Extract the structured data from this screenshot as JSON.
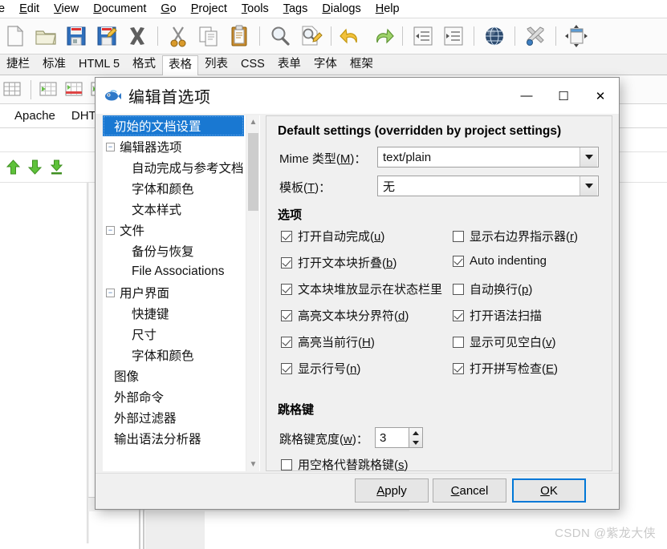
{
  "app": {
    "menubar": [
      {
        "label": "e",
        "full": "File"
      },
      {
        "label": "Edit"
      },
      {
        "label": "View"
      },
      {
        "label": "Document"
      },
      {
        "label": "Go"
      },
      {
        "label": "Project"
      },
      {
        "label": "Tools"
      },
      {
        "label": "Tags"
      },
      {
        "label": "Dialogs"
      },
      {
        "label": "Help"
      }
    ],
    "toolbar_icons": [
      "new-file-icon",
      "open-folder-icon",
      "save-icon",
      "save-as-icon",
      "close-x-icon",
      "cut-scissors-icon",
      "copy-icon",
      "paste-clipboard-icon",
      "find-magnifier-icon",
      "find-replace-icon",
      "undo-arrow-icon",
      "redo-arrow-icon",
      "unindent-icon",
      "indent-icon",
      "preview-globe-icon",
      "preferences-tools-icon",
      "fullscreen-icon"
    ],
    "tabs": [
      {
        "label": "捷栏",
        "active": false
      },
      {
        "label": "标准",
        "active": false
      },
      {
        "label": "HTML 5",
        "active": false
      },
      {
        "label": "格式",
        "active": false
      },
      {
        "label": "表格",
        "active": true
      },
      {
        "label": "列表",
        "active": false
      },
      {
        "label": "CSS",
        "active": false
      },
      {
        "label": "表单",
        "active": false
      },
      {
        "label": "字体",
        "active": false
      },
      {
        "label": "框架",
        "active": false
      }
    ],
    "taglibs": [
      "Apache",
      "DHT"
    ],
    "arrows": [
      "up-arrow-icon",
      "down-arrow-icon",
      "bottom-arrow-icon"
    ]
  },
  "dialog": {
    "title": "编辑首选项",
    "window_buttons": {
      "minimize": "—",
      "maximize": "☐",
      "close": "✕"
    },
    "tree": [
      {
        "label": "初始的文档设置",
        "level": 1,
        "expander": null,
        "selected": true
      },
      {
        "label": "编辑器选项",
        "level": 0,
        "expander": "minus",
        "selected": false
      },
      {
        "label": "自动完成与参考文档",
        "level": 2,
        "expander": null,
        "selected": false
      },
      {
        "label": "字体和颜色",
        "level": 2,
        "expander": null,
        "selected": false
      },
      {
        "label": "文本样式",
        "level": 2,
        "expander": null,
        "selected": false
      },
      {
        "label": "文件",
        "level": 0,
        "expander": "minus",
        "selected": false
      },
      {
        "label": "备份与恢复",
        "level": 2,
        "expander": null,
        "selected": false
      },
      {
        "label": "File Associations",
        "level": 2,
        "expander": null,
        "selected": false
      },
      {
        "label": "用户界面",
        "level": 0,
        "expander": "minus",
        "selected": false
      },
      {
        "label": "快捷键",
        "level": 2,
        "expander": null,
        "selected": false
      },
      {
        "label": "尺寸",
        "level": 2,
        "expander": null,
        "selected": false
      },
      {
        "label": "字体和颜色",
        "level": 2,
        "expander": null,
        "selected": false
      },
      {
        "label": "图像",
        "level": 1,
        "expander": null,
        "selected": false
      },
      {
        "label": "外部命令",
        "level": 1,
        "expander": null,
        "selected": false
      },
      {
        "label": "外部过滤器",
        "level": 1,
        "expander": null,
        "selected": false
      },
      {
        "label": "输出语法分析器",
        "level": 1,
        "expander": null,
        "selected": false
      }
    ],
    "pane": {
      "title": "Default settings (overridden by project settings)",
      "mime_label_pre": "Mime 类型(",
      "mime_label_key": "M",
      "mime_label_post": ")：",
      "mime_value": "text/plain",
      "template_label_pre": "模板(",
      "template_label_key": "T",
      "template_label_post": ")：",
      "template_value": "无",
      "options_header": "选项",
      "options_left": [
        {
          "label_pre": "打开自动完成(",
          "key": "u",
          "label_post": ")",
          "checked": true
        },
        {
          "label_pre": "打开文本块折叠(",
          "key": "b",
          "label_post": ")",
          "checked": true
        },
        {
          "label_pre": "文本块堆放显示在状态栏里",
          "key": "",
          "label_post": "",
          "checked": true
        },
        {
          "label_pre": "高亮文本块分界符(",
          "key": "d",
          "label_post": ")",
          "checked": true
        },
        {
          "label_pre": "高亮当前行(",
          "key": "H",
          "label_post": ")",
          "checked": true
        },
        {
          "label_pre": "显示行号(",
          "key": "n",
          "label_post": ")",
          "checked": true
        }
      ],
      "options_right": [
        {
          "label_pre": "显示右边界指示器(",
          "key": "r",
          "label_post": ")",
          "checked": false
        },
        {
          "label_pre": "Auto indenting",
          "key": "",
          "label_post": "",
          "checked": true
        },
        {
          "label_pre": "自动换行(",
          "key": "p",
          "label_post": ")",
          "checked": false
        },
        {
          "label_pre": "打开语法扫描",
          "key": "",
          "label_post": "",
          "checked": true
        },
        {
          "label_pre": "显示可见空白(",
          "key": "v",
          "label_post": ")",
          "checked": false
        },
        {
          "label_pre": "打开拼写检查(",
          "key": "E",
          "label_post": ")",
          "checked": true
        }
      ],
      "tab_header": "跳格键",
      "tab_width_label_pre": "跳格键宽度(",
      "tab_width_key": "w",
      "tab_width_label_post": ")：",
      "tab_width_value": "3",
      "spaces_instead_pre": "用空格代替跳格键(",
      "spaces_instead_key": "s",
      "spaces_instead_post": ")",
      "spaces_instead_checked": false
    },
    "buttons": {
      "apply_pre": "",
      "apply_key": "A",
      "apply_post": "pply",
      "cancel_pre": "",
      "cancel_key": "C",
      "cancel_post": "ancel",
      "ok_pre": "",
      "ok_key": "O",
      "ok_post": "K"
    }
  },
  "watermark": "CSDN @紫龙大侠",
  "colors": {
    "selection_blue": "#1978d2",
    "default_button_border": "#0078d7",
    "dialog_bg": "#f0f0f0"
  }
}
